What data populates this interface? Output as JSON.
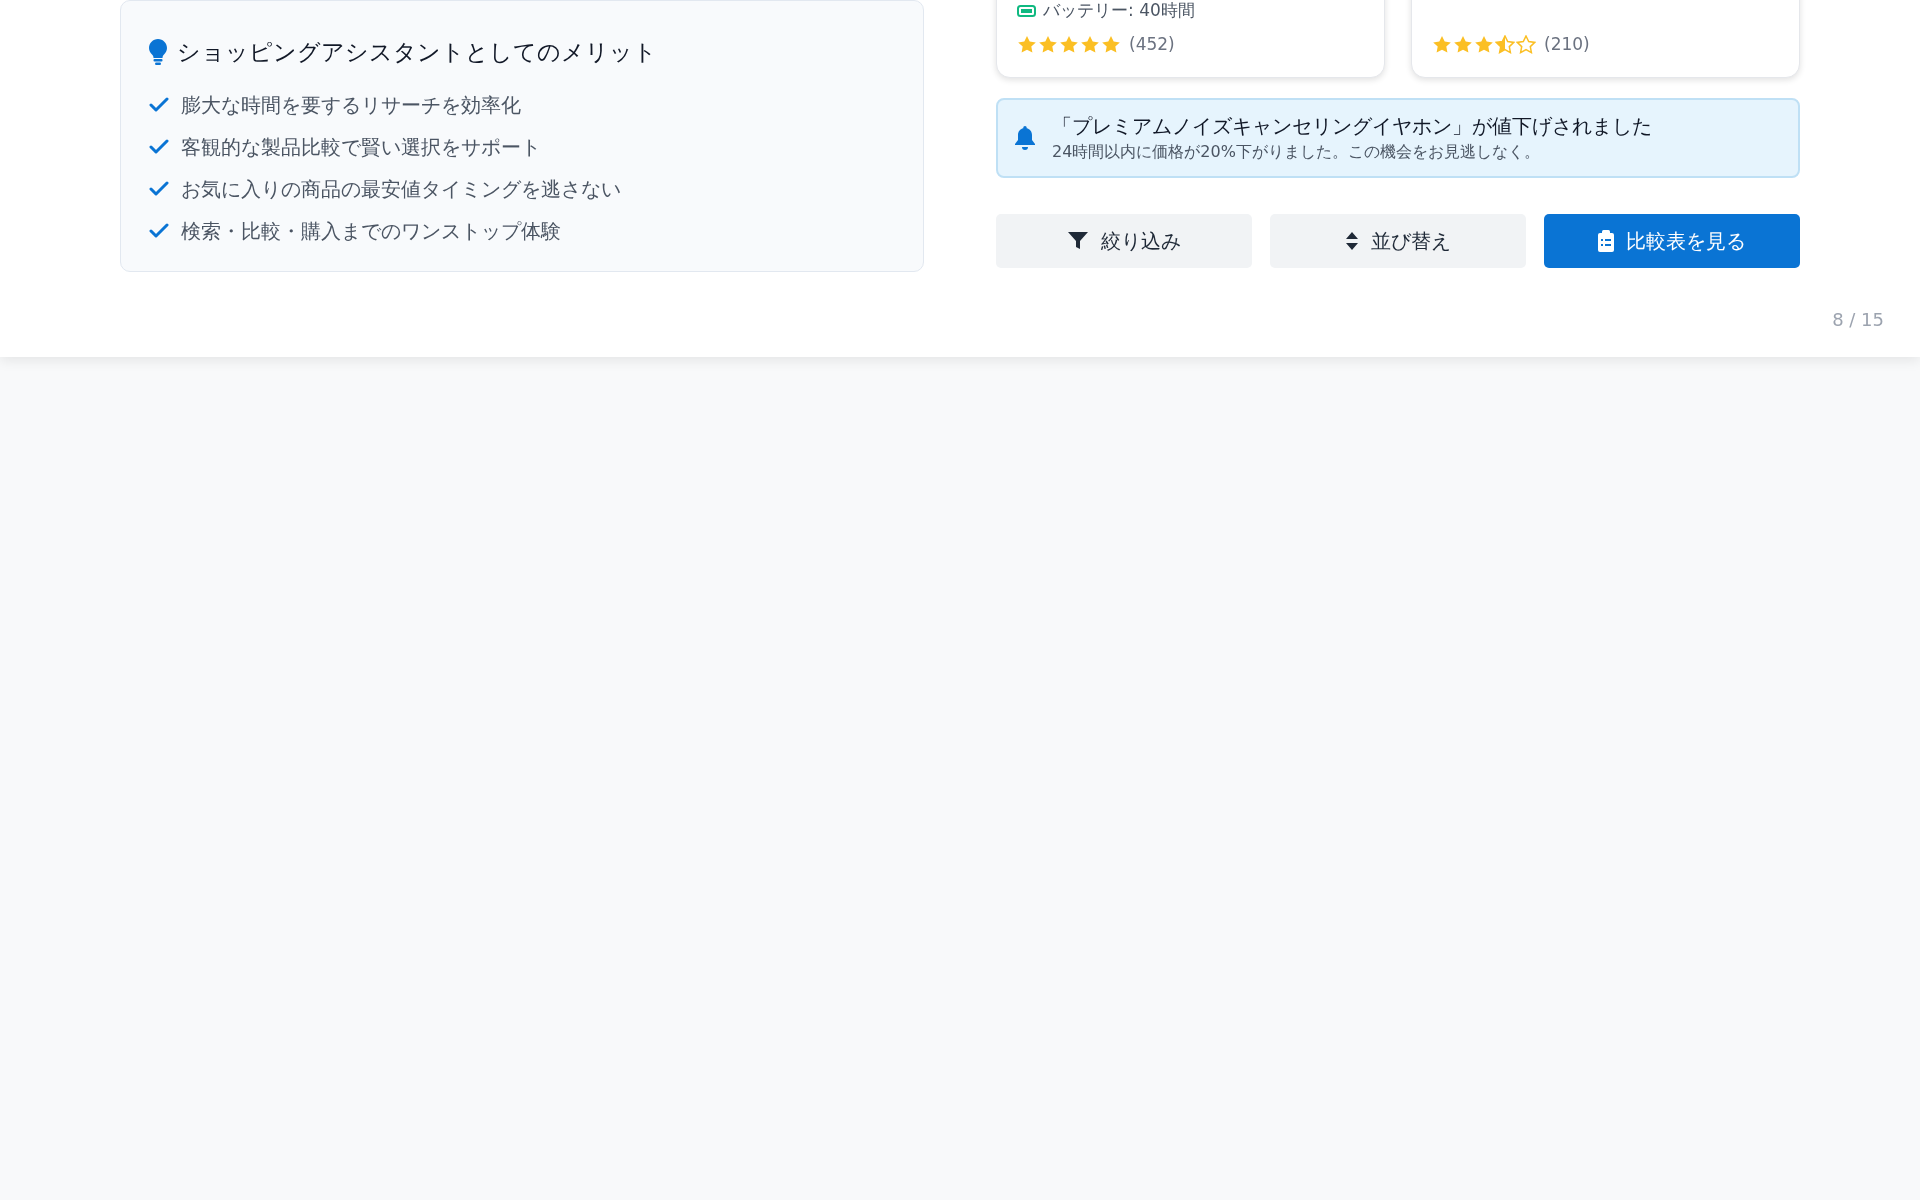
{
  "benefits": {
    "title": "ショッピングアシスタントとしてのメリット",
    "items": [
      "膨大な時間を要するリサーチを効率化",
      "客観的な製品比較で賢い選択をサポート",
      "お気に入りの商品の最安値タイミングを逃さない",
      "検索・比較・購入までのワンストップ体験"
    ]
  },
  "products": [
    {
      "spec": "バッテリー: 40時間",
      "stars": 5,
      "reviews": "(452)"
    },
    {
      "stars": 3.5,
      "reviews": "(210)"
    }
  ],
  "alert": {
    "title": "「プレミアムノイズキャンセリングイヤホン」が値下げされました",
    "message": "24時間以内に価格が20%下がりました。この機会をお見逃しなく。"
  },
  "buttons": [
    {
      "kind": "filter",
      "label": "絞り込み",
      "primary": false
    },
    {
      "kind": "sort",
      "label": "並び替え",
      "primary": false
    },
    {
      "kind": "compare",
      "label": "比較表を見る",
      "primary": true
    }
  ],
  "page_number": "8 / 15"
}
